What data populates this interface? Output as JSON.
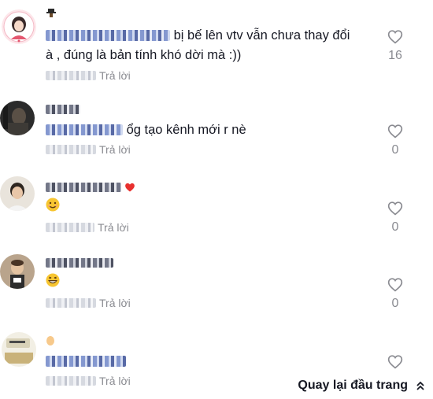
{
  "comments": [
    {
      "text_line1": "bị bế lên vtv vẫn chưa thay đổi",
      "text_line2": "à , đúng là bản tính khó dời mà :))",
      "reply_label": "Trả lời",
      "likes": "16"
    },
    {
      "text": "ổg tạo kênh mới r nè",
      "reply_label": "Trả lời",
      "likes": "0"
    },
    {
      "reply_label": "Trả lời",
      "likes": "0"
    },
    {
      "reply_label": "Trả lời",
      "likes": "0"
    },
    {
      "reply_label": "Trả lời"
    }
  ],
  "back_to_top": {
    "label": "Quay lại đầu trang"
  },
  "icons": {
    "like": "heart-outline-icon",
    "back_to_top": "double-chevron-up-icon"
  },
  "colors": {
    "text": "#161823",
    "muted": "#8a8b91"
  }
}
